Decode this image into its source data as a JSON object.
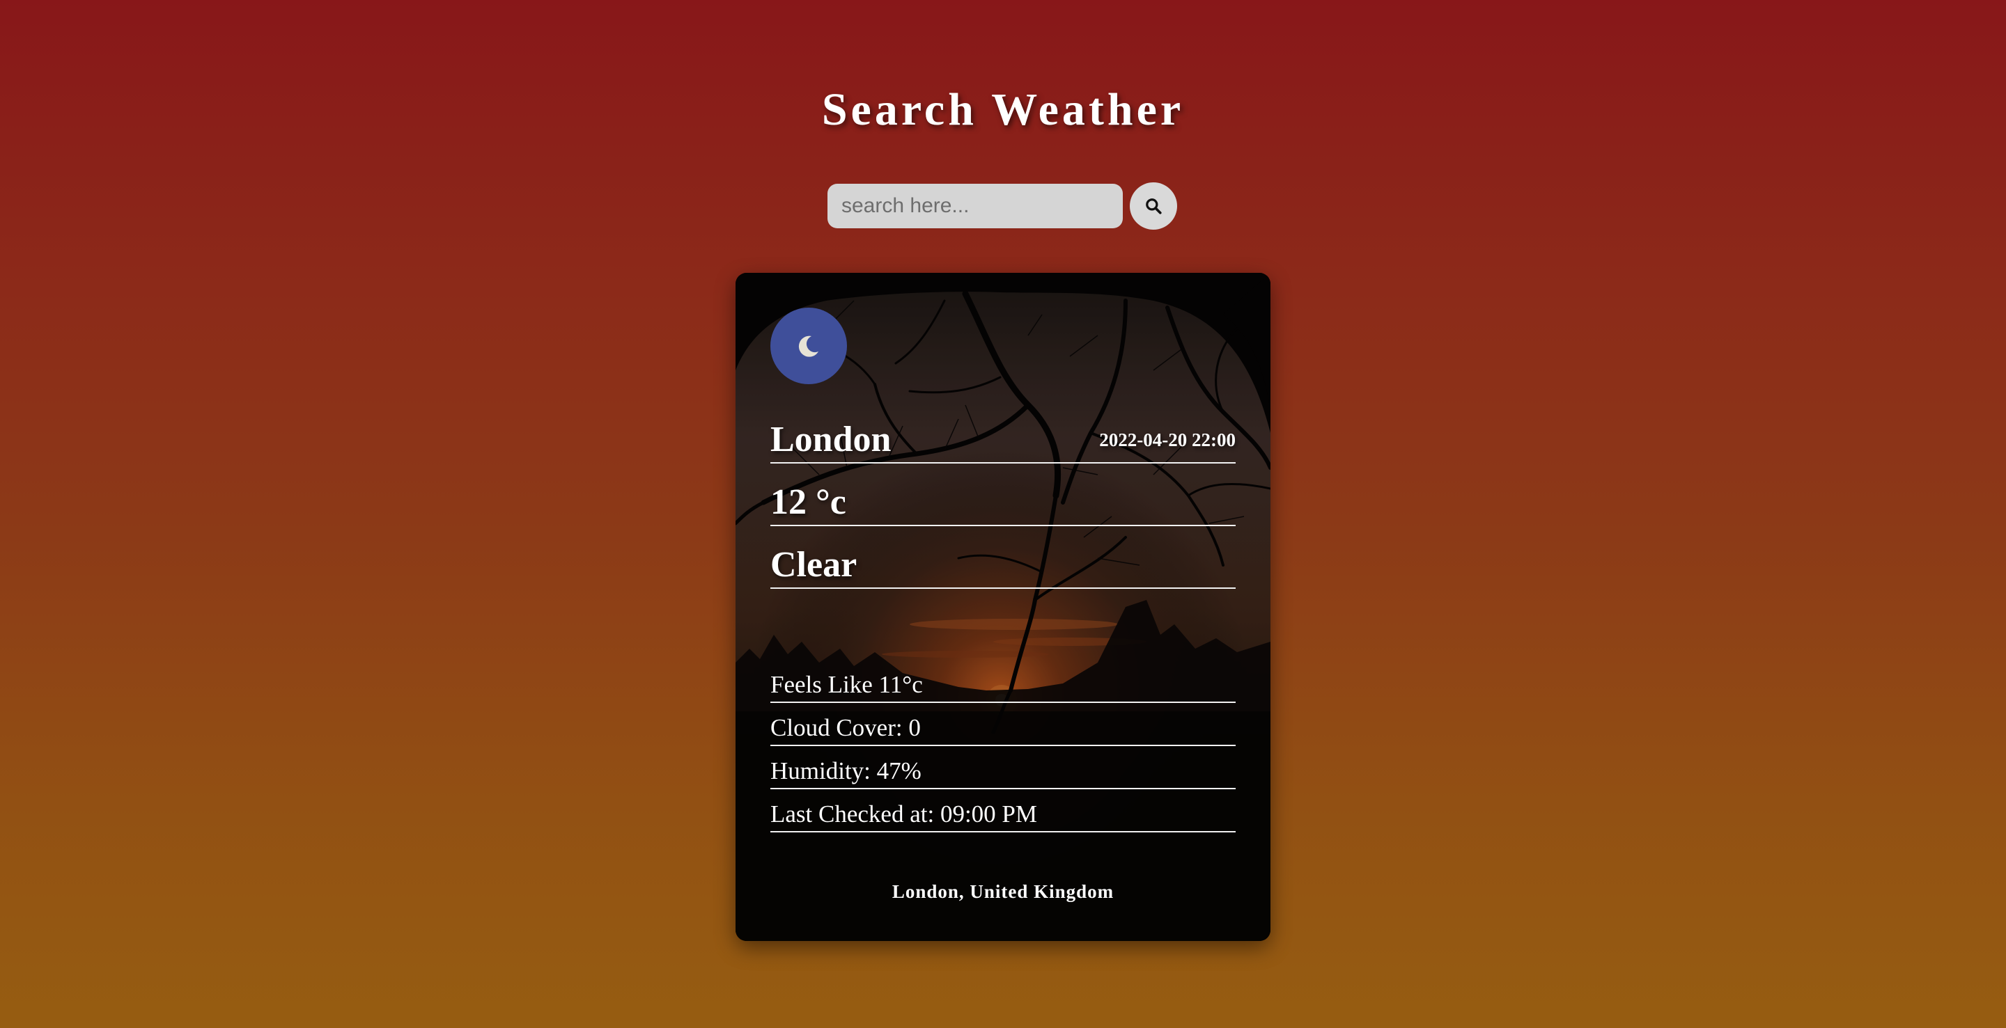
{
  "header": {
    "title": "Search Weather"
  },
  "search": {
    "placeholder": "search here...",
    "value": "",
    "button_icon": "search-icon"
  },
  "weather_card": {
    "condition_icon": "moon-icon",
    "city": "London",
    "datetime": "2022-04-20 22:00",
    "temperature": "12 °c",
    "condition": "Clear",
    "feels_like": "Feels Like 11°c",
    "cloud_cover": "Cloud Cover: 0",
    "humidity": "Humidity: 47%",
    "last_checked": "Last Checked at: 09:00 PM",
    "location": "London, United Kingdom"
  },
  "colors": {
    "background_top": "#881719",
    "background_bottom": "#965d11",
    "icon_circle": "#3f4f9a",
    "text": "#ffffff"
  }
}
